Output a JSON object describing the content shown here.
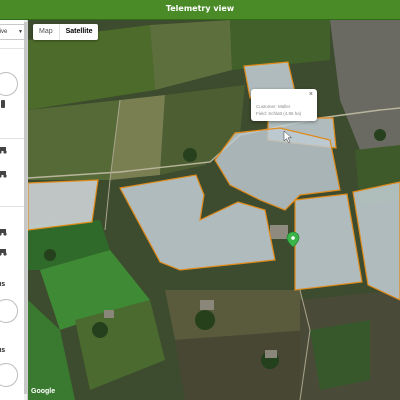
{
  "header": {
    "title": "Telemetry view"
  },
  "sidebar": {
    "filter_value": "ctive",
    "section_labels": [
      "us",
      "us"
    ]
  },
  "map": {
    "type_options": [
      "Map",
      "Satellite"
    ],
    "selected_type": "Satellite",
    "attribution": "Google",
    "accent_color": "#e08a1a",
    "field_color": "#c8d4dc"
  },
  "popup": {
    "customer": "Customer: Müller",
    "field": "Field: Schlatt (4.95 ha)"
  },
  "marker": {
    "icon": "map-pin-icon",
    "color": "#3bb54a"
  }
}
